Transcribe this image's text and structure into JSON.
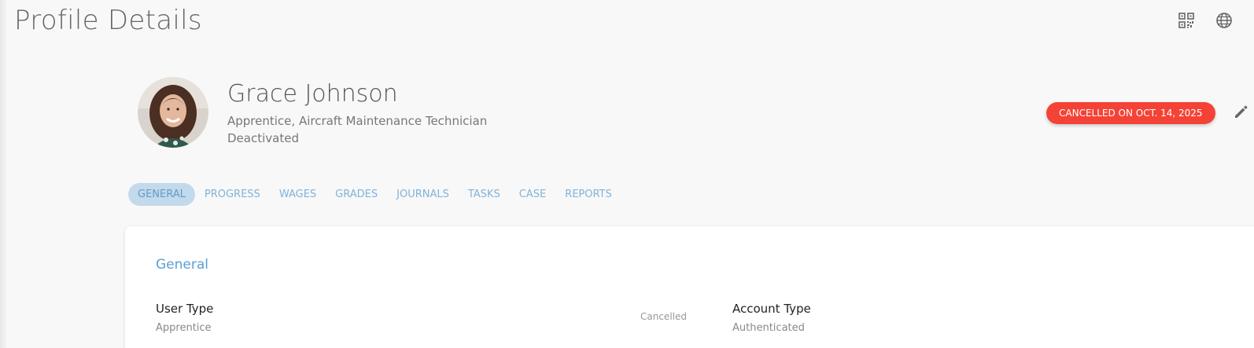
{
  "header": {
    "title": "Profile Details",
    "qr_icon": "qr-code-icon",
    "language_icon": "globe-icon"
  },
  "profile": {
    "name": "Grace Johnson",
    "role": "Apprentice, Aircraft Maintenance Technician",
    "status": "Deactivated",
    "badge": "CANCELLED ON OCT. 14, 2025",
    "edit_icon": "pencil-icon"
  },
  "tabs": [
    {
      "label": "GENERAL",
      "active": true
    },
    {
      "label": "PROGRESS",
      "active": false
    },
    {
      "label": "WAGES",
      "active": false
    },
    {
      "label": "GRADES",
      "active": false
    },
    {
      "label": "JOURNALS",
      "active": false
    },
    {
      "label": "TASKS",
      "active": false
    },
    {
      "label": "CASE",
      "active": false
    },
    {
      "label": "REPORTS",
      "active": false
    }
  ],
  "general": {
    "title": "General",
    "user_type_label": "User Type",
    "user_type_value": "Apprentice",
    "user_type_status": "Cancelled",
    "account_type_label": "Account Type",
    "account_type_value": "Authenticated"
  },
  "colors": {
    "badge": "#f44336",
    "tab_text": "#7fb3da",
    "tab_active_bg": "#c3d9ec",
    "section_title": "#5a9fd4"
  }
}
